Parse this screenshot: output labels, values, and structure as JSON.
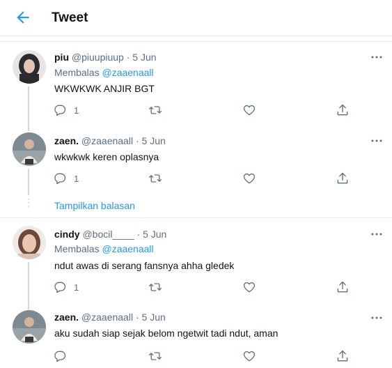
{
  "header": {
    "title": "Tweet"
  },
  "tweets": [
    {
      "name": "piu",
      "handle": "@piuupiuup",
      "sep": "·",
      "date": "5 Jun",
      "reply_prefix": "Membalas",
      "reply_to": "@zaaenaall",
      "text": "WKWKWK ANJIR BGT",
      "reply_count": "1"
    },
    {
      "name": "zaen.",
      "handle": "@zaaenaall",
      "sep": "·",
      "date": "5 Jun",
      "text": "wkwkwk keren oplasnya",
      "reply_count": "1"
    },
    {
      "name": "cindy",
      "handle": "@bocil____",
      "sep": "·",
      "date": "5 Jun",
      "reply_prefix": "Membalas",
      "reply_to": "@zaaenaall",
      "text": "ndut awas di serang fansnya ahha gledek",
      "reply_count": "1"
    },
    {
      "name": "zaen.",
      "handle": "@zaaenaall",
      "sep": "·",
      "date": "5 Jun",
      "text": "aku sudah siap sejak belom ngetwit tadi ndut, aman",
      "reply_count": ""
    }
  ],
  "show_replies": "Tampilkan balasan",
  "colors": {
    "accent": "#1d9bf0",
    "muted": "#5b7083",
    "line": "#cfd9de"
  },
  "icons": [
    "back-arrow-icon",
    "more-icon",
    "reply-icon",
    "retweet-icon",
    "like-icon",
    "share-icon"
  ]
}
